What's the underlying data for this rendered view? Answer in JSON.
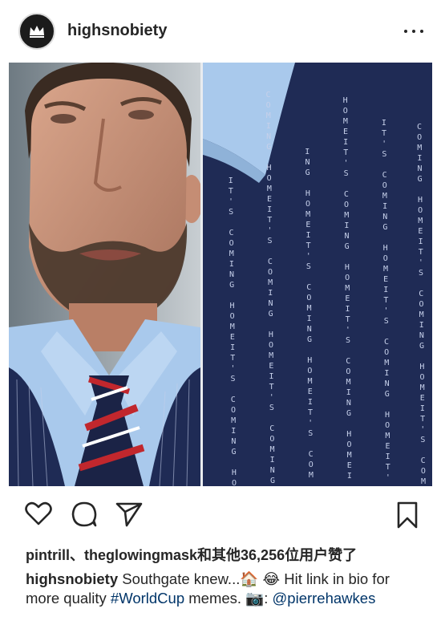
{
  "post": {
    "username": "highsnobiety",
    "avatar_icon": "crown-logo-icon",
    "more_icon": "more-options-icon"
  },
  "actions": {
    "like_icon": "heart-icon",
    "comment_icon": "comment-icon",
    "share_icon": "share-paper-plane-icon",
    "save_icon": "bookmark-icon"
  },
  "likes": {
    "user1": "pintrill",
    "sep": "、",
    "user2": "theglowingmask",
    "rest": "和其他36,256位用户赞了"
  },
  "caption": {
    "username": "highsnobiety",
    "text1": " Southgate knew...",
    "emoji1": "🏠",
    "emoji2": "😂",
    "text2": " Hit link in bio for more quality ",
    "hashtag": "#WorldCup",
    "text3": " memes. ",
    "emoji3": "📷",
    "text4": ": ",
    "mention": "@pierrehawkes"
  },
  "image": {
    "suit_text": [
      "I",
      "T",
      "'",
      "S",
      " ",
      "C",
      "O",
      "M",
      "I",
      "N",
      "G",
      " ",
      "H",
      "O",
      "M",
      "E"
    ]
  },
  "colors": {
    "suit": "#1f2b55",
    "pinstripe": "#c6d0ea",
    "shirt": "#a9c9ec",
    "tie_red": "#c1272d",
    "link": "#003569"
  }
}
